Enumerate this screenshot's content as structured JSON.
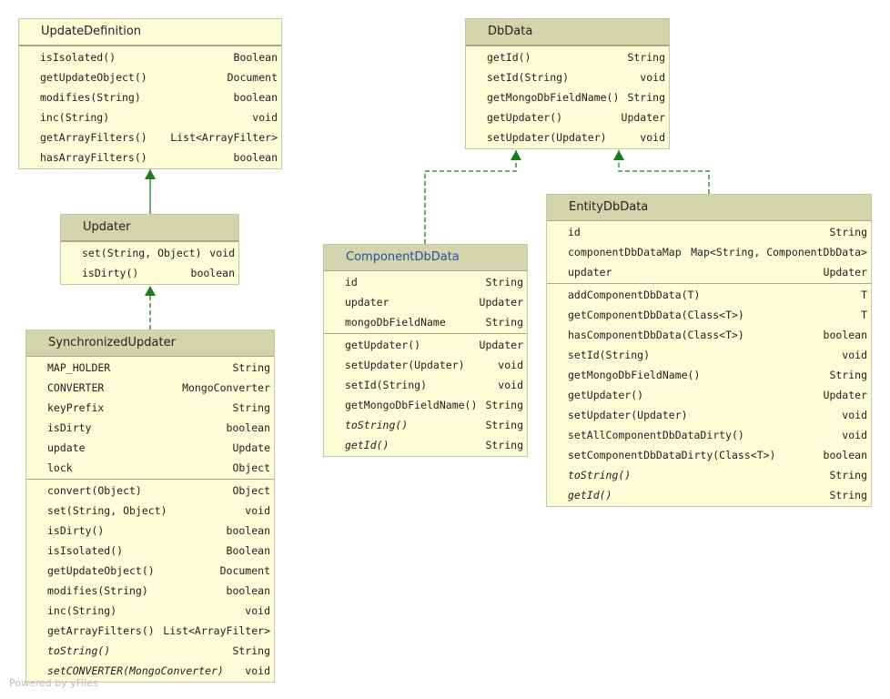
{
  "watermark": "Powered by yFiles",
  "colors": {
    "edge": "#1f7a1f",
    "header_bg": "#d4d4ac",
    "body_bg": "#fcfcd6",
    "interface_title": "#2a4f9a"
  },
  "classes": {
    "updateDefinition": {
      "name": "UpdateDefinition",
      "fields": [],
      "methods": [
        {
          "name": "isIsolated()",
          "type": "Boolean"
        },
        {
          "name": "getUpdateObject()",
          "type": "Document"
        },
        {
          "name": "modifies(String)",
          "type": "boolean"
        },
        {
          "name": "inc(String)",
          "type": "void"
        },
        {
          "name": "getArrayFilters()",
          "type": "List<ArrayFilter>"
        },
        {
          "name": "hasArrayFilters()",
          "type": "boolean"
        }
      ]
    },
    "updater": {
      "name": "Updater",
      "fields": [],
      "methods": [
        {
          "name": "set(String, Object)",
          "type": "void"
        },
        {
          "name": "isDirty()",
          "type": "boolean"
        }
      ]
    },
    "synchronizedUpdater": {
      "name": "SynchronizedUpdater",
      "fields": [
        {
          "name": "MAP_HOLDER",
          "type": "String"
        },
        {
          "name": "CONVERTER",
          "type": "MongoConverter"
        },
        {
          "name": "keyPrefix",
          "type": "String"
        },
        {
          "name": "isDirty",
          "type": "boolean"
        },
        {
          "name": "update",
          "type": "Update"
        },
        {
          "name": "lock",
          "type": "Object"
        }
      ],
      "methods": [
        {
          "name": "convert(Object)",
          "type": "Object"
        },
        {
          "name": "set(String, Object)",
          "type": "void"
        },
        {
          "name": "isDirty()",
          "type": "boolean"
        },
        {
          "name": "isIsolated()",
          "type": "Boolean"
        },
        {
          "name": "getUpdateObject()",
          "type": "Document"
        },
        {
          "name": "modifies(String)",
          "type": "boolean"
        },
        {
          "name": "inc(String)",
          "type": "void"
        },
        {
          "name": "getArrayFilters()",
          "type": "List<ArrayFilter>"
        },
        {
          "name": "toString()",
          "type": "String",
          "italic": true
        },
        {
          "name": "setCONVERTER(MongoConverter)",
          "type": "void",
          "italic": true
        }
      ]
    },
    "dbData": {
      "name": "DbData",
      "fields": [],
      "methods": [
        {
          "name": "getId()",
          "type": "String"
        },
        {
          "name": "setId(String)",
          "type": "void"
        },
        {
          "name": "getMongoDbFieldName()",
          "type": "String"
        },
        {
          "name": "getUpdater()",
          "type": "Updater"
        },
        {
          "name": "setUpdater(Updater)",
          "type": "void"
        }
      ]
    },
    "componentDbData": {
      "name": "ComponentDbData",
      "fields": [
        {
          "name": "id",
          "type": "String"
        },
        {
          "name": "updater",
          "type": "Updater"
        },
        {
          "name": "mongoDbFieldName",
          "type": "String"
        }
      ],
      "methods": [
        {
          "name": "getUpdater()",
          "type": "Updater"
        },
        {
          "name": "setUpdater(Updater)",
          "type": "void"
        },
        {
          "name": "setId(String)",
          "type": "void"
        },
        {
          "name": "getMongoDbFieldName()",
          "type": "String"
        },
        {
          "name": "toString()",
          "type": "String",
          "italic": true
        },
        {
          "name": "getId()",
          "type": "String",
          "italic": true
        }
      ]
    },
    "entityDbData": {
      "name": "EntityDbData",
      "fields": [
        {
          "name": "id",
          "type": "String"
        },
        {
          "name": "componentDbDataMap",
          "type": "Map<String, ComponentDbData>"
        },
        {
          "name": "updater",
          "type": "Updater"
        }
      ],
      "methods": [
        {
          "name": "addComponentDbData(T)",
          "type": "T"
        },
        {
          "name": "getComponentDbData(Class<T>)",
          "type": "T"
        },
        {
          "name": "hasComponentDbData(Class<T>)",
          "type": "boolean"
        },
        {
          "name": "setId(String)",
          "type": "void"
        },
        {
          "name": "getMongoDbFieldName()",
          "type": "String"
        },
        {
          "name": "getUpdater()",
          "type": "Updater"
        },
        {
          "name": "setUpdater(Updater)",
          "type": "void"
        },
        {
          "name": "setAllComponentDbDataDirty()",
          "type": "void"
        },
        {
          "name": "setComponentDbDataDirty(Class<T>)",
          "type": "boolean"
        },
        {
          "name": "toString()",
          "type": "String",
          "italic": true
        },
        {
          "name": "getId()",
          "type": "String",
          "italic": true
        }
      ]
    }
  }
}
